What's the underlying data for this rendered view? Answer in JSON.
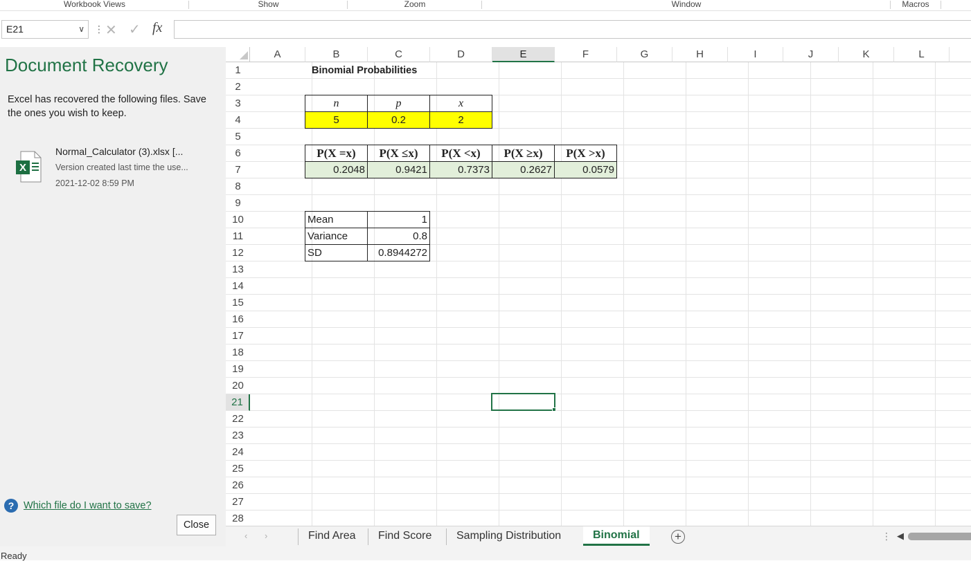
{
  "ribbon": {
    "groups": [
      {
        "label": "Workbook Views"
      },
      {
        "label": "Show"
      },
      {
        "label": "Zoom"
      },
      {
        "label": "Window"
      },
      {
        "label": "Macros"
      }
    ]
  },
  "formula_bar": {
    "name_box": "E21",
    "formula": ""
  },
  "recovery": {
    "title": "Document Recovery",
    "description": "Excel has recovered the following files. Save the ones you wish to keep.",
    "file": {
      "name": "Normal_Calculator (3).xlsx  [...",
      "description": "Version created last time the use...",
      "date": "2021-12-02 8:59 PM",
      "icon": "excel-file-icon"
    },
    "help_link": "Which file do I want to save?",
    "close_label": "Close"
  },
  "grid": {
    "columns": [
      "A",
      "B",
      "C",
      "D",
      "E",
      "F",
      "G",
      "H",
      "I",
      "J",
      "K",
      "L"
    ],
    "selected_column": "E",
    "rows": [
      "1",
      "2",
      "3",
      "4",
      "5",
      "6",
      "7",
      "8",
      "9",
      "10",
      "11",
      "12",
      "13",
      "14",
      "15",
      "16",
      "17",
      "18",
      "19",
      "20",
      "21",
      "22",
      "23",
      "24",
      "25",
      "26",
      "27",
      "28"
    ],
    "selected_row": "21",
    "cells": {
      "B1": "Binomial Probabilities",
      "B3": "n",
      "C3": "p",
      "D3": "x",
      "B4": "5",
      "C4": "0.2",
      "D4": "2",
      "B6": "P(X =x)",
      "C6": "P(X  ≤x)",
      "D6": "P(X <x)",
      "E6": "P(X  ≥x)",
      "F6": "P(X >x)",
      "B7": "0.2048",
      "C7": "0.9421",
      "D7": "0.7373",
      "E7": "0.2627",
      "F7": "0.0579",
      "B10": "Mean",
      "C10": "1",
      "B11": "Variance",
      "C11": "0.8",
      "B12": "SD",
      "C12": "0.8944272"
    },
    "colors": {
      "input_fill": "#ffff00",
      "result_fill": "#e2efda",
      "accent": "#217346"
    }
  },
  "sheet_tabs": {
    "tabs": [
      "Find Area",
      "Find Score",
      "Sampling Distribution",
      "Binomial"
    ],
    "active": "Binomial"
  },
  "status": {
    "text": "Ready"
  }
}
